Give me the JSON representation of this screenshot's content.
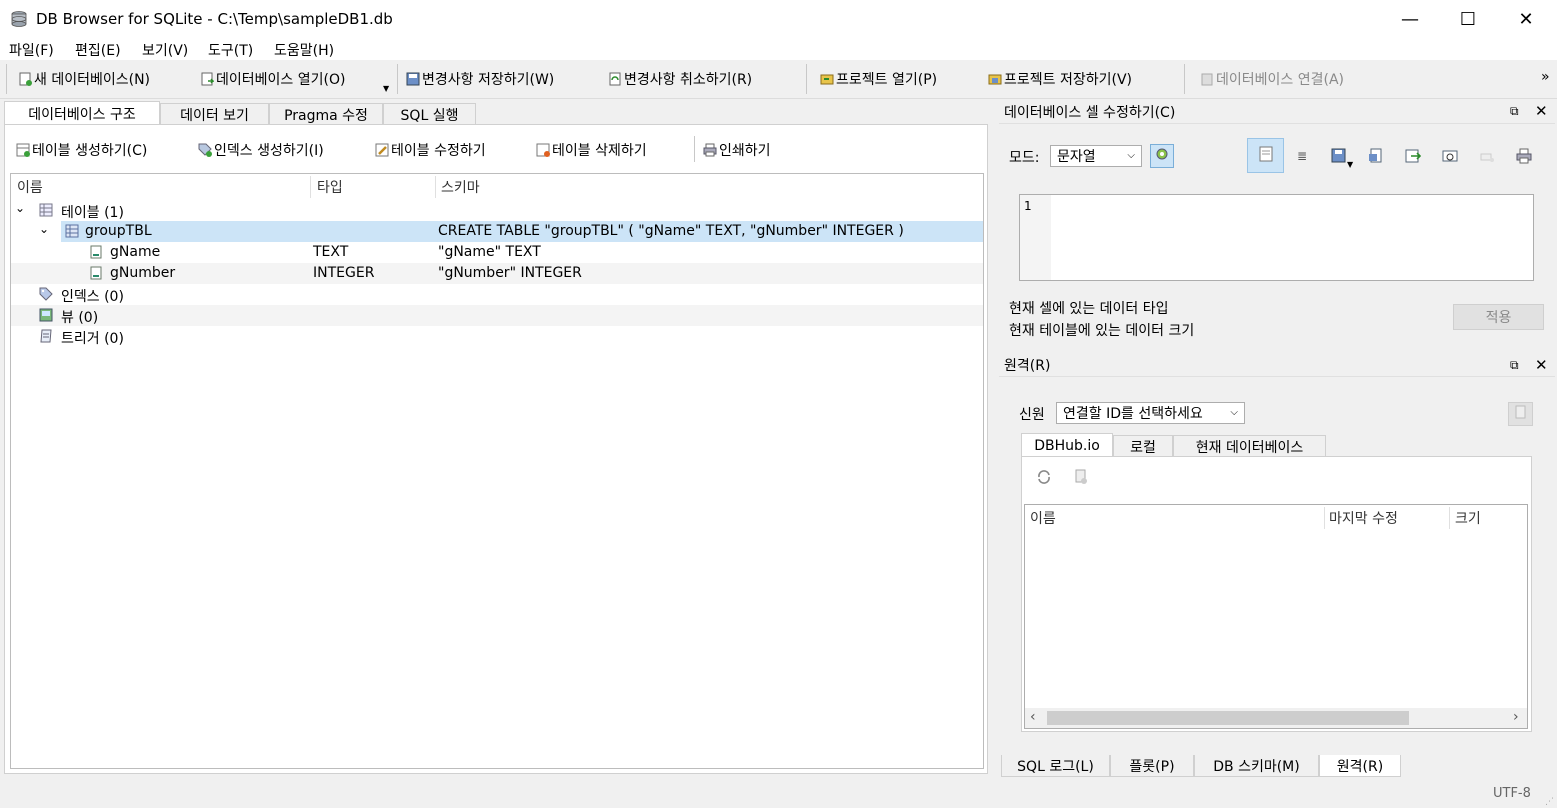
{
  "window": {
    "title": "DB Browser for SQLite - C:\\Temp\\sampleDB1.db",
    "minimize_glyph": "—",
    "maximize_glyph": "☐",
    "close_glyph": "✕"
  },
  "menu": [
    "파일(F)",
    "편집(E)",
    "보기(V)",
    "도구(T)",
    "도움말(H)"
  ],
  "toolbar": {
    "new_db": "새 데이터베이스(N)",
    "open_db": "데이터베이스 열기(O)",
    "write_changes": "변경사항 저장하기(W)",
    "revert_changes": "변경사항 취소하기(R)",
    "open_project": "프로젝트 열기(P)",
    "save_project": "프로젝트 저장하기(V)",
    "attach_db": "데이터베이스 연결(A)",
    "overflow": "»"
  },
  "main_tabs": [
    "데이터베이스 구조",
    "데이터 보기",
    "Pragma 수정",
    "SQL 실행"
  ],
  "structure_toolbar": {
    "create_table": "테이블 생성하기(C)",
    "create_index": "인덱스 생성하기(I)",
    "modify_table": "테이블 수정하기",
    "delete_table": "테이블 삭제하기",
    "print": "인쇄하기"
  },
  "tree": {
    "headers": {
      "name": "이름",
      "type": "타입",
      "schema": "스키마"
    },
    "tables_label": "테이블 (1)",
    "table": {
      "name": "groupTBL",
      "schema": "CREATE TABLE \"groupTBL\" ( \"gName\" TEXT, \"gNumber\" INTEGER )",
      "columns": [
        {
          "name": "gName",
          "type": "TEXT",
          "schema": "\"gName\" TEXT"
        },
        {
          "name": "gNumber",
          "type": "INTEGER",
          "schema": "\"gNumber\" INTEGER"
        }
      ]
    },
    "indices_label": "인덱스 (0)",
    "views_label": "뷰 (0)",
    "triggers_label": "트리거 (0)"
  },
  "edit_cell": {
    "title": "데이터베이스 셀 수정하기(C)",
    "mode_label": "모드:",
    "mode_value": "문자열",
    "line_number": "1",
    "type_info": "현재 셀에 있는 데이터 타입",
    "size_info": "현재 테이블에 있는 데이터 크기",
    "apply_button": "적용"
  },
  "remote": {
    "title": "원격(R)",
    "identity_label": "신원",
    "identity_value": "연결할 ID를 선택하세요",
    "tabs": [
      "DBHub.io",
      "로컬",
      "현재 데이터베이스"
    ],
    "columns": [
      "이름",
      "마지막 수정",
      "크기"
    ]
  },
  "bottom_tabs": [
    "SQL 로그(L)",
    "플롯(P)",
    "DB 스키마(M)",
    "원격(R)"
  ],
  "status": {
    "encoding": "UTF-8"
  },
  "colors": {
    "selection": "#cce4f7",
    "active_icon_bg": "#cce4f7"
  }
}
